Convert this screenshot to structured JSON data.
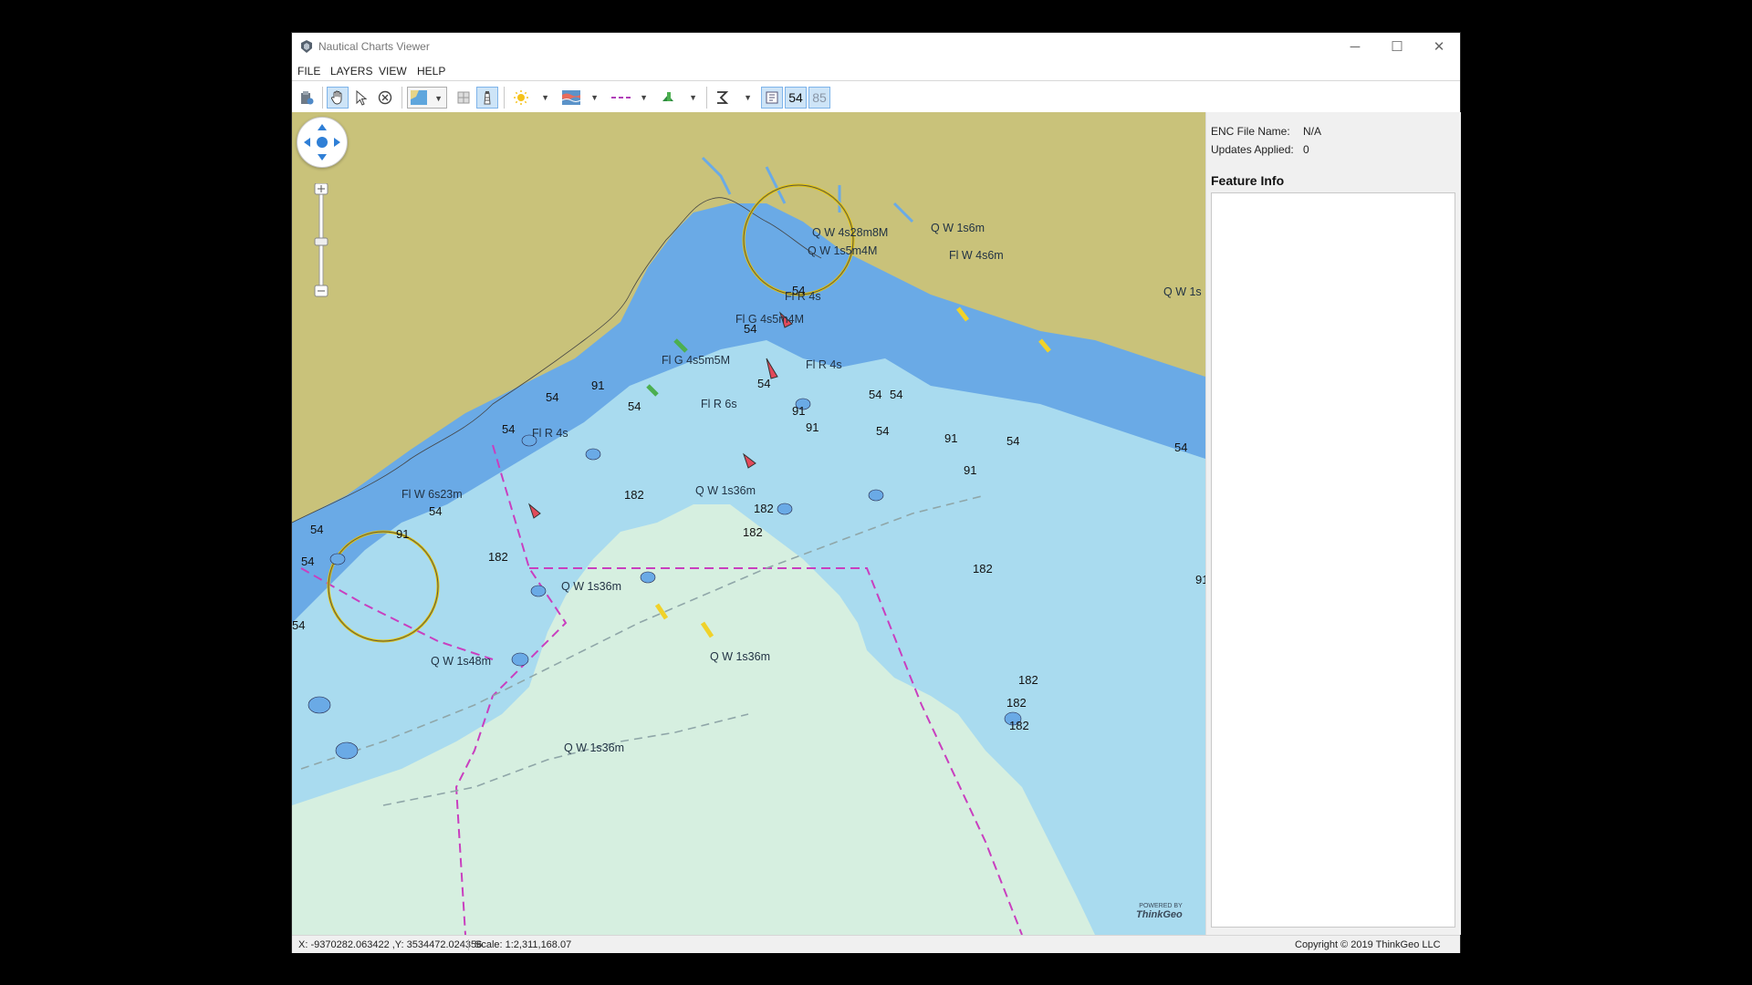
{
  "window": {
    "title": "Nautical Charts Viewer",
    "minimize_glyph": "─",
    "maximize_glyph": "☐",
    "close_glyph": "✕"
  },
  "menu": [
    "FILE",
    "LAYERS",
    "VIEW",
    "HELP"
  ],
  "toolbar": {
    "icons": [
      "open-chart-icon",
      "pan-hand-icon",
      "select-arrow-icon",
      "clear-icon",
      "base-map-icon",
      "boundary-icon",
      "lighthouse-icon",
      "day-night-icon",
      "color-scheme-icon",
      "line-style-icon",
      "symbol-icon",
      "measure-icon",
      "soundings-feet-icon",
      "soundings-depth-icon"
    ],
    "soundings_label_a": "54",
    "soundings_label_b": "85"
  },
  "side_panel": {
    "enc_file_label": "ENC File Name:",
    "enc_file_value": "N/A",
    "updates_label": "Updates Applied:",
    "updates_value": "0",
    "feature_info_title": "Feature Info"
  },
  "status": {
    "coords": "X:  -9370282.063422 ,Y:  3534472.024356",
    "scale": "Scale: 1:2,311,168.07",
    "copyright": "Copyright © 2019 ThinkGeo LLC"
  },
  "map": {
    "labels": {
      "l1": "Q W 4s28m8M",
      "l2": "Q W 1s6m",
      "l3": "Q W 1s5m4M",
      "l4": "Fl W 4s6m",
      "l5": "Q W 1s",
      "l6": "Fl R 4s",
      "l7": "Fl G 4s5m4M",
      "l8": "Fl G 4s5m5M",
      "l9": "Fl R 4s",
      "l10": "Fl R 6s",
      "l11": "Fl R 4s",
      "l12": "Fl W 6s23m",
      "l13": "Q W 1s36m",
      "l14": "Q W 1s36m",
      "l15": "Q W 1s48m",
      "l16": "Q W 1s36m",
      "l17": "Q W 1s36m"
    },
    "soundings": {
      "s1": "54",
      "s2": "54",
      "s3": "54",
      "s4": "54",
      "s5": "54",
      "s6": "54",
      "s7": "54",
      "s8": "54",
      "s9": "54",
      "s10": "54",
      "s11": "54",
      "s12": "54",
      "s13": "91",
      "s14": "91",
      "s15": "91",
      "s16": "91",
      "s17": "91",
      "s18": "91",
      "s19": "182",
      "s20": "182",
      "s21": "182",
      "s22": "182",
      "s23": "182",
      "s24": "182",
      "s25": "182",
      "s26": "182",
      "s27": "54",
      "s28": "54",
      "s29": "91",
      "s30": "54"
    },
    "watermark_line1": "POWERED BY",
    "watermark_line2": "ThinkGeo"
  }
}
